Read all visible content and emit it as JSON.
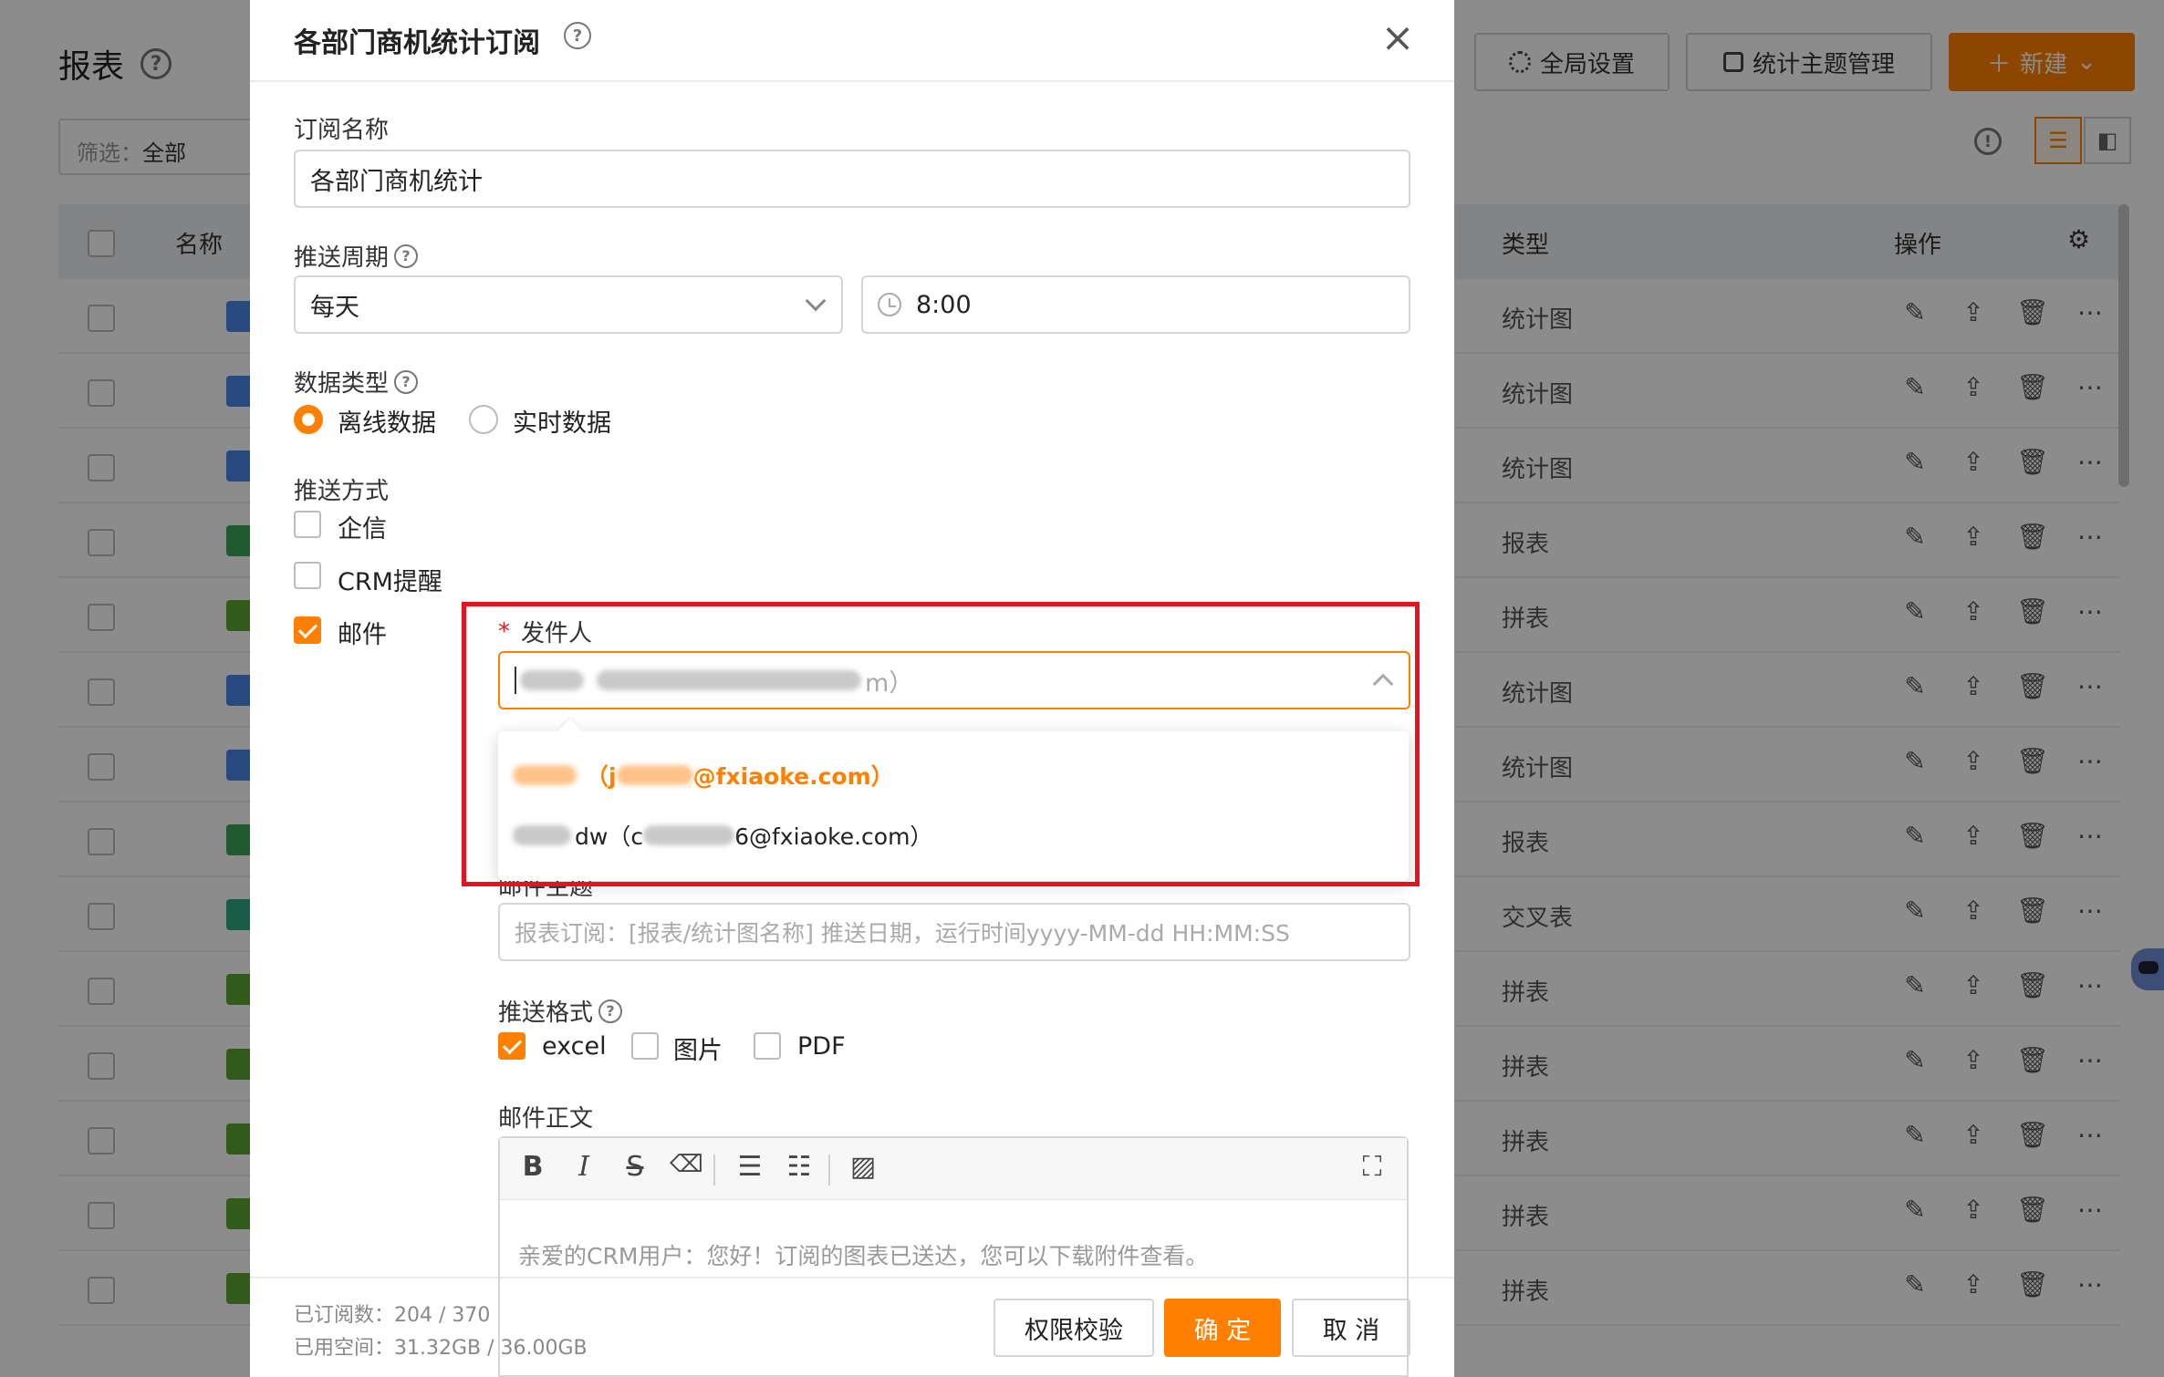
{
  "background": {
    "title": "报表",
    "filter_label": "筛选：",
    "filter_value": "全部",
    "buttons": {
      "global_settings": "全局设置",
      "theme_manage": "统计主题管理",
      "new": "新建"
    },
    "table": {
      "col_name": "名称",
      "col_type": "类型",
      "col_ops": "操作",
      "rows": [
        {
          "type": "统计图",
          "icon_color": "#4a86e8"
        },
        {
          "type": "统计图",
          "icon_color": "#4a86e8"
        },
        {
          "type": "统计图",
          "icon_color": "#4a86e8"
        },
        {
          "type": "报表",
          "icon_color": "#3aa757"
        },
        {
          "type": "拼表",
          "icon_color": "#5ba632"
        },
        {
          "type": "统计图",
          "icon_color": "#4a86e8"
        },
        {
          "type": "统计图",
          "icon_color": "#4a86e8"
        },
        {
          "type": "报表",
          "icon_color": "#3aa757"
        },
        {
          "type": "交叉表",
          "icon_color": "#2fa884"
        },
        {
          "type": "拼表",
          "icon_color": "#5ba632"
        },
        {
          "type": "拼表",
          "icon_color": "#5ba632"
        },
        {
          "type": "拼表",
          "icon_color": "#5ba632"
        },
        {
          "type": "拼表",
          "icon_color": "#5ba632"
        },
        {
          "type": "拼表",
          "icon_color": "#5ba632"
        }
      ]
    }
  },
  "modal": {
    "title": "各部门商机统计订阅",
    "close": "×",
    "subscription_name_label": "订阅名称",
    "subscription_name_value": "各部门商机统计",
    "push_cycle_label": "推送周期",
    "push_cycle_value": "每天",
    "push_time_value": "8:00",
    "data_type_label": "数据类型",
    "data_type_options": [
      "离线数据",
      "实时数据"
    ],
    "push_method_label": "推送方式",
    "push_methods": [
      "企信",
      "CRM提醒",
      "邮件"
    ],
    "sender_label": "发件人",
    "sender_required": "*",
    "sender_suffix": "m）",
    "dropdown_options": [
      {
        "prefix": "（j",
        "suffix": "@fxiaoke.com）"
      },
      {
        "prefix": "dw（c",
        "suffix": "6@fxiaoke.com）"
      }
    ],
    "email_subject_label": "邮件主题",
    "email_subject_placeholder": "报表订阅：[报表/统计图名称] 推送日期，运行时间yyyy-MM-dd HH:MM:SS",
    "push_format_label": "推送格式",
    "push_formats": [
      "excel",
      "图片",
      "PDF"
    ],
    "email_body_label": "邮件正文",
    "email_body_text": "亲爱的CRM用户：您好！订阅的图表已送达，您可以下载附件查看。",
    "toolbar": {
      "bold": "B",
      "italic": "I",
      "strike": "S",
      "eraser": "⌫",
      "ul": "☰",
      "ol": "☷",
      "image": "▨",
      "fullscreen": "⛶"
    },
    "footer": {
      "subscribed": "已订阅数：204 / 370",
      "used_space": "已用空间：31.32GB / 36.00GB",
      "check_btn": "权限校验",
      "ok_btn": "确 定",
      "cancel_btn": "取 消"
    }
  },
  "colors": {
    "accent": "#ff8000",
    "highlight": "#e3141e"
  }
}
